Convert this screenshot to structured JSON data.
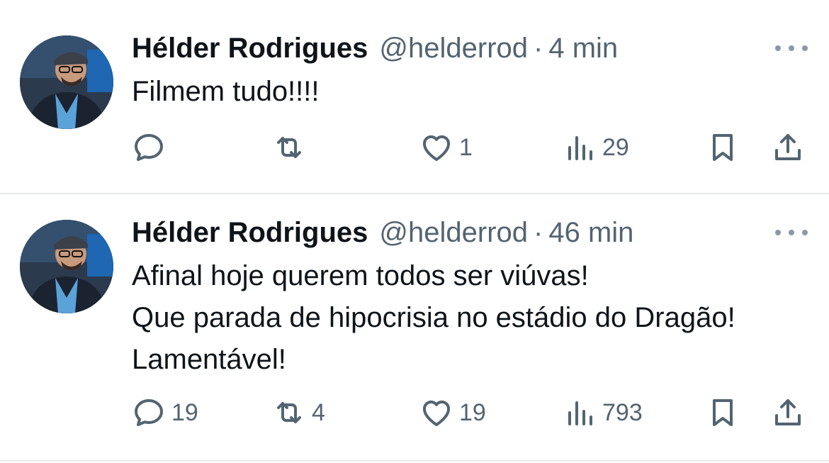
{
  "tweets": [
    {
      "author": {
        "name": "Hélder Rodrigues",
        "handle": "@helderrod"
      },
      "separator": "·",
      "time": "4 min",
      "text_lines": [
        "Filmem tudo!!!!"
      ],
      "stats": {
        "replies": "",
        "retweets": "",
        "likes": "1",
        "views": "29"
      }
    },
    {
      "author": {
        "name": "Hélder Rodrigues",
        "handle": "@helderrod"
      },
      "separator": "·",
      "time": "46 min",
      "text_lines": [
        "Afinal hoje querem todos ser viúvas!",
        "Que parada de hipocrisia no estádio do Dragão!",
        "Lamentável!"
      ],
      "stats": {
        "replies": "19",
        "retweets": "4",
        "likes": "19",
        "views": "793"
      }
    }
  ],
  "icons": {
    "reply": "speech-bubble-icon",
    "retweet": "retweet-arrows-icon",
    "like": "heart-icon",
    "views": "bar-chart-icon",
    "bookmark": "bookmark-icon",
    "share": "share-upload-icon",
    "more": "more-dots-icon"
  },
  "colors": {
    "text": "#0f1419",
    "secondary": "#536471",
    "divider": "#e7e9ea"
  }
}
